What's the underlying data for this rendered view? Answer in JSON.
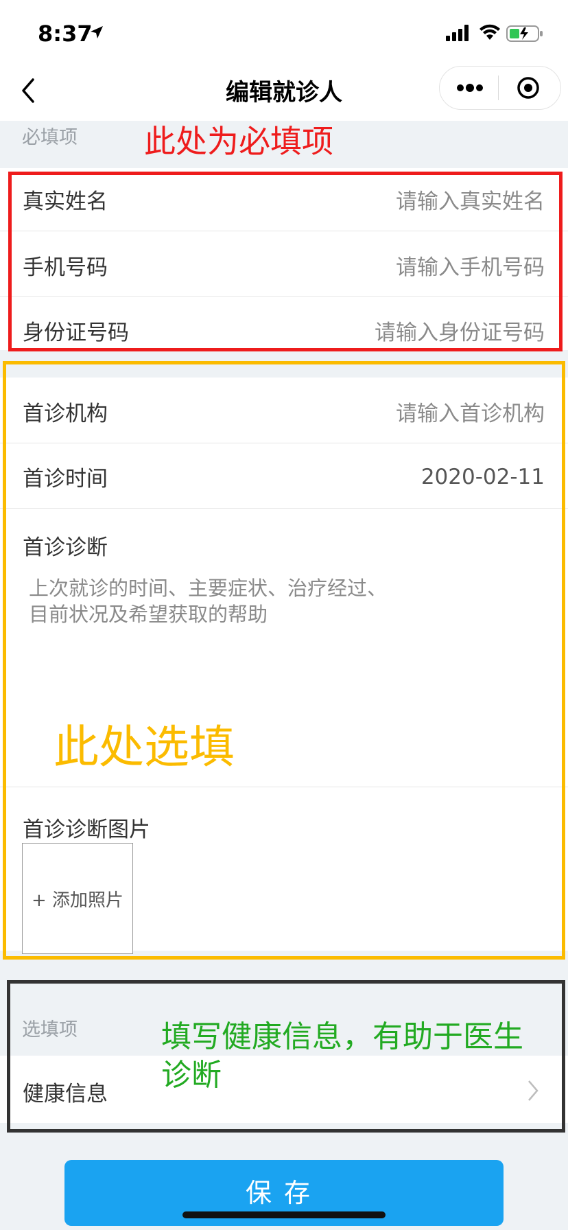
{
  "status_bar": {
    "time": "8:37"
  },
  "nav": {
    "title": "编辑就诊人"
  },
  "required_section": {
    "label": "必填项",
    "annotation": "此处为必填项",
    "fields": [
      {
        "label": "真实姓名",
        "placeholder": "请输入真实姓名"
      },
      {
        "label": "手机号码",
        "placeholder": "请输入手机号码"
      },
      {
        "label": "身份证号码",
        "placeholder": "请输入身份证号码"
      }
    ]
  },
  "optional_first_visit": {
    "annotation": "此处选填",
    "institution": {
      "label": "首诊机构",
      "placeholder": "请输入首诊机构"
    },
    "time": {
      "label": "首诊时间",
      "value": "2020-02-11"
    },
    "diagnosis": {
      "label": "首诊诊断",
      "placeholder": "上次就诊的时间、主要症状、治疗经过、目前状况及希望获取的帮助"
    },
    "images": {
      "label": "首诊诊断图片",
      "add_label": "+ 添加照片"
    }
  },
  "optional_section": {
    "label": "选填项",
    "annotation": "填写健康信息，有助于医生诊断",
    "health_info": {
      "label": "健康信息"
    }
  },
  "save_button": {
    "label": "保存"
  },
  "colors": {
    "required_box": "#ee1c1c",
    "optional_box": "#fbbb00",
    "health_box": "#333333",
    "health_annotation": "#22aa22",
    "save_button": "#1aa3f1"
  }
}
